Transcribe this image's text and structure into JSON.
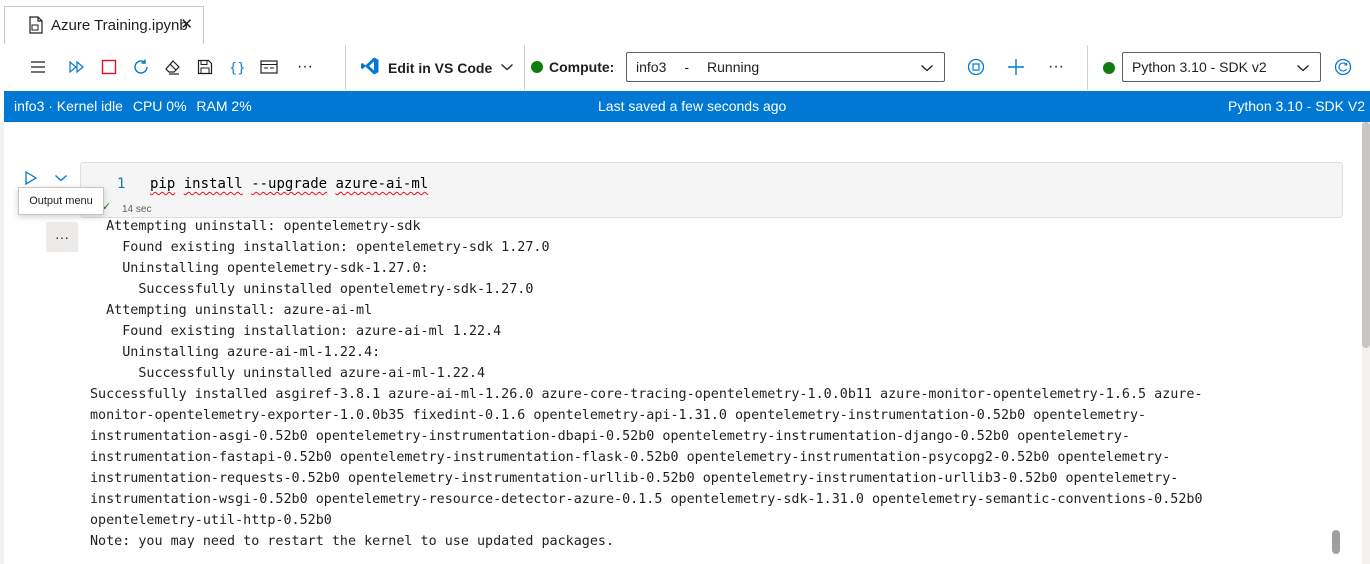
{
  "tab": {
    "title": "Azure Training.ipynb",
    "close": "✕"
  },
  "toolbar": {
    "vscode_label": "Edit in VS Code",
    "compute_label": "Compute:",
    "compute_name": "info3",
    "compute_sep": "-",
    "compute_status": "Running",
    "kernel_name": "Python 3.10 - SDK v2",
    "more": "···"
  },
  "status": {
    "compute": "info3 · Kernel idle",
    "cpu": "CPU  0%",
    "ram": "RAM  2%",
    "saved": "Last saved a few seconds ago",
    "kernel": "Python 3.10 - SDK V2",
    "accent": "#0078d4"
  },
  "cell": {
    "line_number": "1",
    "code_parts": [
      "pip",
      " ",
      "install",
      " ",
      "--upgrade",
      " ",
      "azure-ai-ml"
    ],
    "exec_time": "14 sec",
    "tooltip": "Output menu",
    "output_menu": "···"
  },
  "output_lines": [
    "  Attempting uninstall: opentelemetry-sdk",
    "    Found existing installation: opentelemetry-sdk 1.27.0",
    "    Uninstalling opentelemetry-sdk-1.27.0:",
    "      Successfully uninstalled opentelemetry-sdk-1.27.0",
    "  Attempting uninstall: azure-ai-ml",
    "    Found existing installation: azure-ai-ml 1.22.4",
    "    Uninstalling azure-ai-ml-1.22.4:",
    "      Successfully uninstalled azure-ai-ml-1.22.4",
    "Successfully installed asgiref-3.8.1 azure-ai-ml-1.26.0 azure-core-tracing-opentelemetry-1.0.0b11 azure-monitor-opentelemetry-1.6.5 azure-",
    "monitor-opentelemetry-exporter-1.0.0b35 fixedint-0.1.6 opentelemetry-api-1.31.0 opentelemetry-instrumentation-0.52b0 opentelemetry-",
    "instrumentation-asgi-0.52b0 opentelemetry-instrumentation-dbapi-0.52b0 opentelemetry-instrumentation-django-0.52b0 opentelemetry-",
    "instrumentation-fastapi-0.52b0 opentelemetry-instrumentation-flask-0.52b0 opentelemetry-instrumentation-psycopg2-0.52b0 opentelemetry-",
    "instrumentation-requests-0.52b0 opentelemetry-instrumentation-urllib-0.52b0 opentelemetry-instrumentation-urllib3-0.52b0 opentelemetry-",
    "instrumentation-wsgi-0.52b0 opentelemetry-resource-detector-azure-0.1.5 opentelemetry-sdk-1.31.0 opentelemetry-semantic-conventions-0.52b0",
    "opentelemetry-util-http-0.52b0",
    "Note: you may need to restart the kernel to use updated packages."
  ]
}
